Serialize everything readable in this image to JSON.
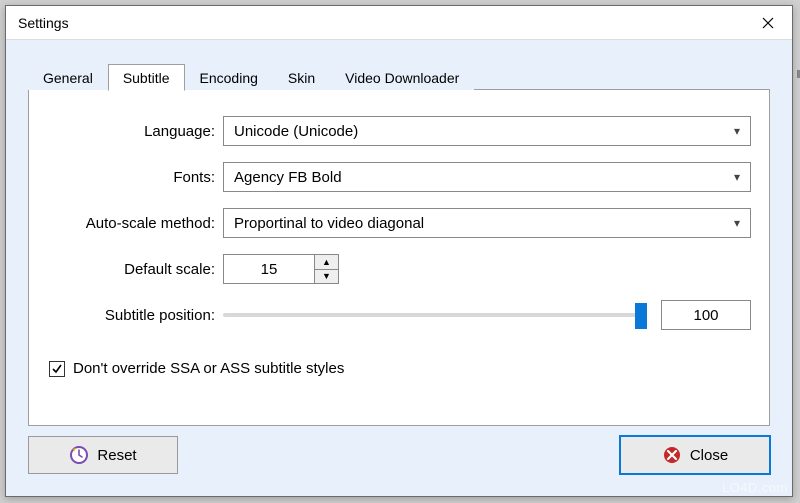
{
  "window": {
    "title": "Settings"
  },
  "tabs": [
    {
      "label": "General"
    },
    {
      "label": "Subtitle"
    },
    {
      "label": "Encoding"
    },
    {
      "label": "Skin"
    },
    {
      "label": "Video Downloader"
    }
  ],
  "active_tab_index": 1,
  "subtitle": {
    "language_label": "Language:",
    "language_value": "Unicode (Unicode)",
    "fonts_label": "Fonts:",
    "fonts_value": "Agency FB Bold",
    "autoscale_label": "Auto-scale method:",
    "autoscale_value": "Proportinal to video diagonal",
    "defaultscale_label": "Default scale:",
    "defaultscale_value": "15",
    "position_label": "Subtitle position:",
    "position_value": "100",
    "checkbox_label": "Don't override SSA or ASS subtitle styles",
    "checkbox_checked": true
  },
  "footer": {
    "reset_label": "Reset",
    "close_label": "Close"
  },
  "watermark": "LO4D.com"
}
